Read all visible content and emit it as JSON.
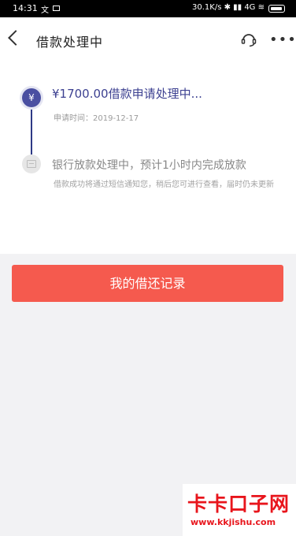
{
  "status_bar": {
    "time": "14:31",
    "left_icons": "文",
    "right_text": "30.1K/s ✱ ▮▮ 4G ≋"
  },
  "header": {
    "title": "借款处理中",
    "more": "•••"
  },
  "progress": {
    "step1": {
      "icon": "¥",
      "title": "¥1700.00借款申请处理中...",
      "time": "申请时间：2019-12-17"
    },
    "step2": {
      "title": "银行放款处理中，预计1小时内完成放款",
      "desc": "借款成功将通过短信通知您，稍后您可进行查看，届时仍未更新"
    }
  },
  "button": {
    "label": "我的借还记录"
  },
  "watermark": {
    "title": "卡卡口子网",
    "url": "www.kkjishu.com"
  },
  "colors": {
    "accent": "#3d4191",
    "button": "#f55a4e",
    "watermark": "#e8151c"
  }
}
